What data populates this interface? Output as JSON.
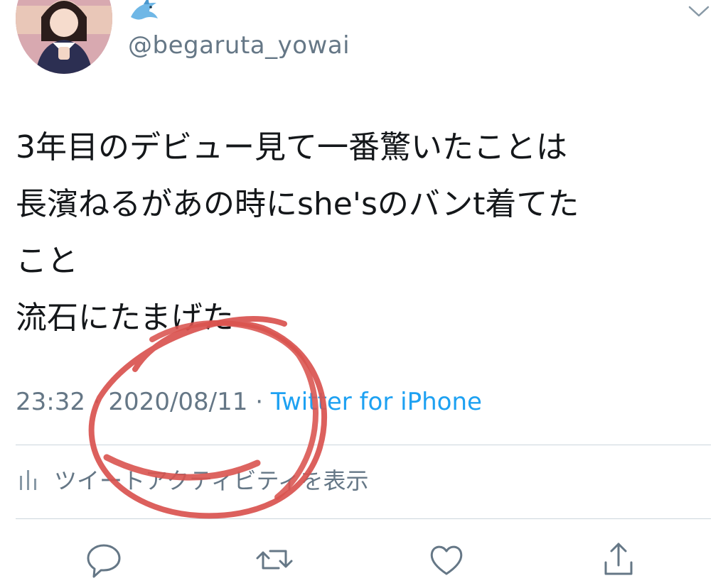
{
  "user": {
    "emoji_name": "🐬",
    "handle": "@begaruta_yowai"
  },
  "tweet": {
    "text": "3年目のデビュー見て一番驚いたことは\n長濱ねるがあの時にshe'sのバンt着てた\nこと\n流石にたまげた",
    "time": "23:32",
    "date": "2020/08/11",
    "separator": "·",
    "source": "Twitter for iPhone"
  },
  "activity": {
    "label": "ツイートアクティビティを表示"
  },
  "actions": [
    {
      "icon": "reply-icon"
    },
    {
      "icon": "retweet-icon"
    },
    {
      "icon": "like-icon"
    },
    {
      "icon": "share-icon"
    }
  ],
  "colors": {
    "text": "#14171a",
    "secondary": "#657786",
    "link": "#1da1f2",
    "divider": "#ccd6dd",
    "annotation": "#d9534f"
  }
}
